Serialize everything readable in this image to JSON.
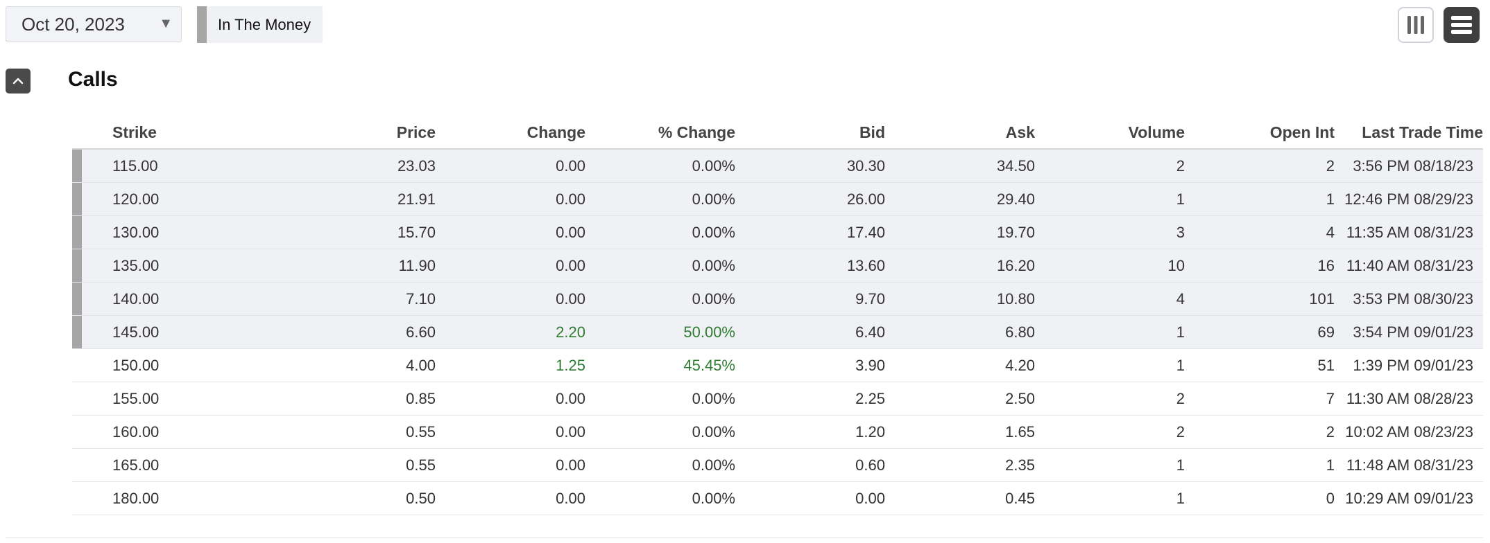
{
  "toolbar": {
    "expiration_date": "Oct 20, 2023",
    "itm_legend_label": "In The Money"
  },
  "section": {
    "title": "Calls"
  },
  "columns": [
    "Strike",
    "Price",
    "Change",
    "% Change",
    "Bid",
    "Ask",
    "Volume",
    "Open Int",
    "Last Trade Time"
  ],
  "rows": [
    {
      "strike": "115.00",
      "price": "23.03",
      "change": "0.00",
      "pct_change": "0.00%",
      "bid": "30.30",
      "ask": "34.50",
      "volume": "2",
      "open_int": "2",
      "last_trade": "3:56 PM 08/18/23",
      "in_the_money": true,
      "positive": false
    },
    {
      "strike": "120.00",
      "price": "21.91",
      "change": "0.00",
      "pct_change": "0.00%",
      "bid": "26.00",
      "ask": "29.40",
      "volume": "1",
      "open_int": "1",
      "last_trade": "12:46 PM 08/29/23",
      "in_the_money": true,
      "positive": false
    },
    {
      "strike": "130.00",
      "price": "15.70",
      "change": "0.00",
      "pct_change": "0.00%",
      "bid": "17.40",
      "ask": "19.70",
      "volume": "3",
      "open_int": "4",
      "last_trade": "11:35 AM 08/31/23",
      "in_the_money": true,
      "positive": false
    },
    {
      "strike": "135.00",
      "price": "11.90",
      "change": "0.00",
      "pct_change": "0.00%",
      "bid": "13.60",
      "ask": "16.20",
      "volume": "10",
      "open_int": "16",
      "last_trade": "11:40 AM 08/31/23",
      "in_the_money": true,
      "positive": false
    },
    {
      "strike": "140.00",
      "price": "7.10",
      "change": "0.00",
      "pct_change": "0.00%",
      "bid": "9.70",
      "ask": "10.80",
      "volume": "4",
      "open_int": "101",
      "last_trade": "3:53 PM 08/30/23",
      "in_the_money": true,
      "positive": false
    },
    {
      "strike": "145.00",
      "price": "6.60",
      "change": "2.20",
      "pct_change": "50.00%",
      "bid": "6.40",
      "ask": "6.80",
      "volume": "1",
      "open_int": "69",
      "last_trade": "3:54 PM 09/01/23",
      "in_the_money": true,
      "positive": true
    },
    {
      "strike": "150.00",
      "price": "4.00",
      "change": "1.25",
      "pct_change": "45.45%",
      "bid": "3.90",
      "ask": "4.20",
      "volume": "1",
      "open_int": "51",
      "last_trade": "1:39 PM 09/01/23",
      "in_the_money": false,
      "positive": true
    },
    {
      "strike": "155.00",
      "price": "0.85",
      "change": "0.00",
      "pct_change": "0.00%",
      "bid": "2.25",
      "ask": "2.50",
      "volume": "2",
      "open_int": "7",
      "last_trade": "11:30 AM 08/28/23",
      "in_the_money": false,
      "positive": false
    },
    {
      "strike": "160.00",
      "price": "0.55",
      "change": "0.00",
      "pct_change": "0.00%",
      "bid": "1.20",
      "ask": "1.65",
      "volume": "2",
      "open_int": "2",
      "last_trade": "10:02 AM 08/23/23",
      "in_the_money": false,
      "positive": false
    },
    {
      "strike": "165.00",
      "price": "0.55",
      "change": "0.00",
      "pct_change": "0.00%",
      "bid": "0.60",
      "ask": "2.35",
      "volume": "1",
      "open_int": "1",
      "last_trade": "11:48 AM 08/31/23",
      "in_the_money": false,
      "positive": false
    },
    {
      "strike": "180.00",
      "price": "0.50",
      "change": "0.00",
      "pct_change": "0.00%",
      "bid": "0.00",
      "ask": "0.45",
      "volume": "1",
      "open_int": "0",
      "last_trade": "10:29 AM 09/01/23",
      "in_the_money": false,
      "positive": false
    }
  ],
  "icons": {
    "date_dropdown": "caret-down-icon",
    "columns_view": "columns-view-icon",
    "rows_view": "list-view-icon",
    "collapse": "chevron-up-icon"
  },
  "colors": {
    "itm_marker": "#a6a6a6",
    "itm_row_bg": "#f0f1f4",
    "positive_change": "#2e7d32",
    "active_view_button": "#3f3f3f"
  }
}
